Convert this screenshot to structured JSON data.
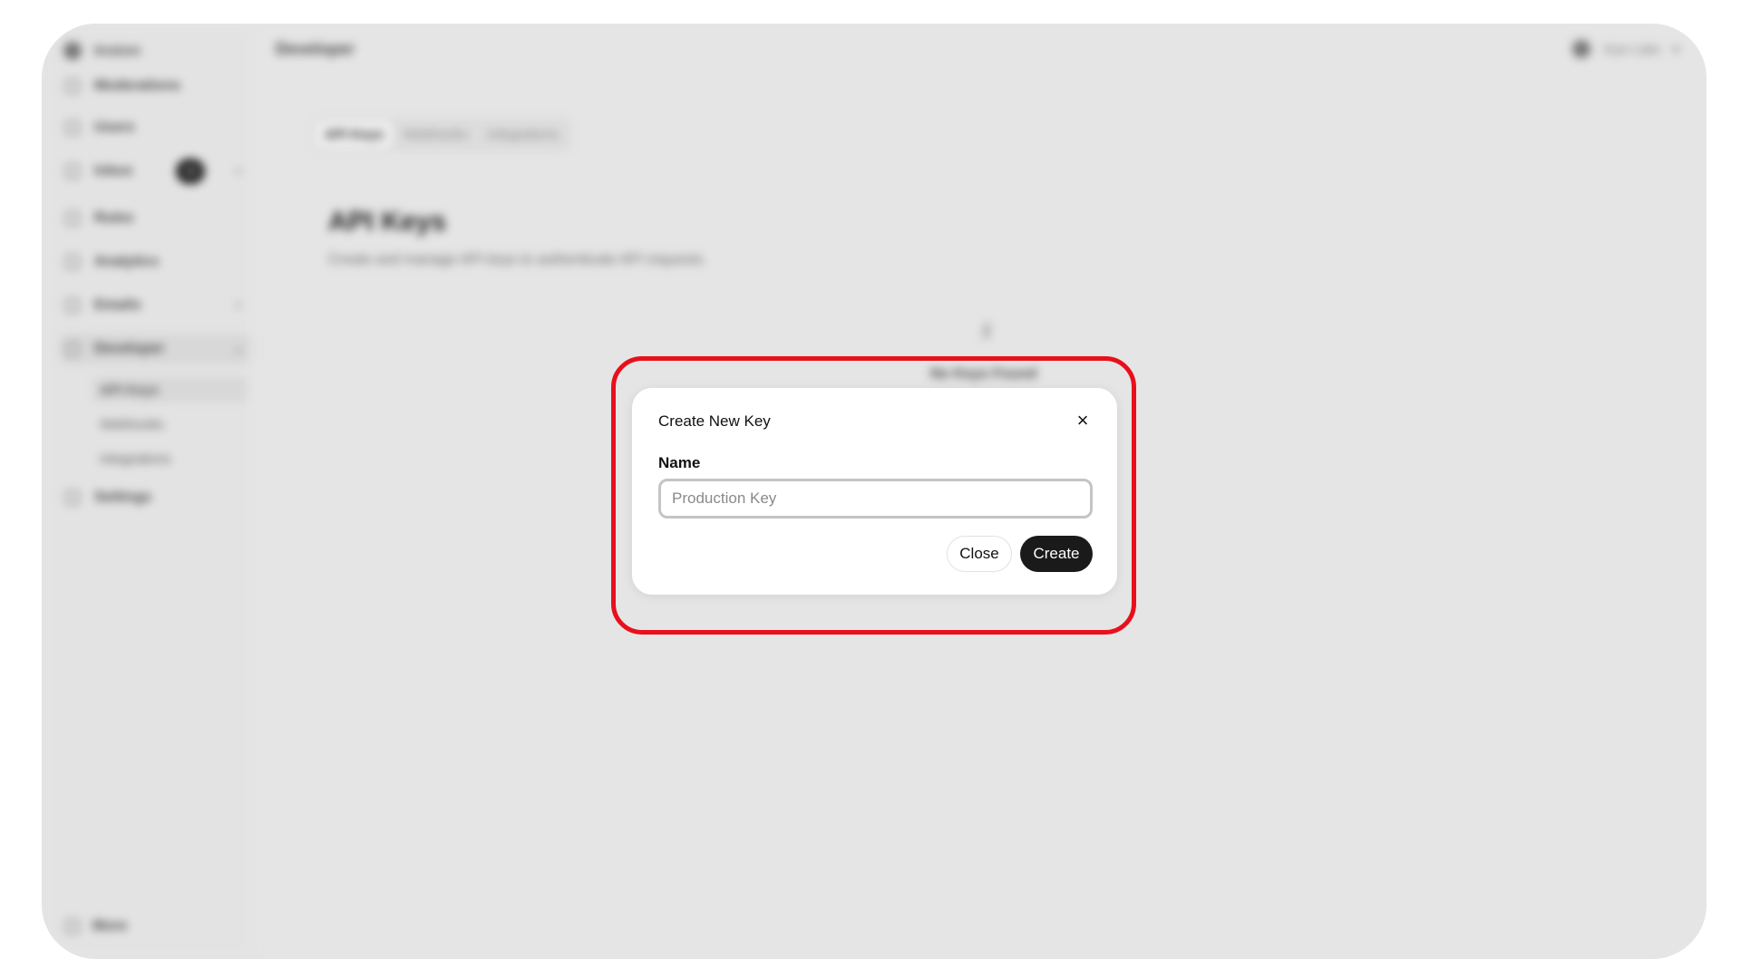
{
  "app": {
    "brand": "Inston",
    "topbar_title": "Developer",
    "user_name": "Aryn Labs"
  },
  "sidebar": {
    "items": [
      {
        "label": "Moderations",
        "icon": "list-icon"
      },
      {
        "label": "Users",
        "icon": "users-icon"
      },
      {
        "label": "Inbox",
        "icon": "inbox-icon",
        "badge": "12"
      },
      {
        "label": "Rules",
        "icon": "rules-icon"
      },
      {
        "label": "Analytics",
        "icon": "analytics-icon"
      },
      {
        "label": "Emails",
        "icon": "mail-icon"
      },
      {
        "label": "Developer",
        "icon": "code-icon"
      },
      {
        "label": "Settings",
        "icon": "gear-icon"
      }
    ],
    "developer_sub": [
      "API Keys",
      "Webhooks",
      "Integrations"
    ],
    "more_label": "More"
  },
  "main": {
    "tabs": [
      "API Keys",
      "Webhooks",
      "Integrations"
    ],
    "heading": "API Keys",
    "subtitle": "Create and manage API keys to authenticate API requests.",
    "empty_text": "No Keys Found"
  },
  "dialog": {
    "title": "Create New Key",
    "field_label": "Name",
    "field_placeholder": "Production Key",
    "field_value": "",
    "close_label": "Close",
    "create_label": "Create",
    "close_icon": "×"
  },
  "colors": {
    "highlight": "#e8101a",
    "primary_button": "#1a1a1a",
    "backdrop": "#e5e5e5"
  }
}
